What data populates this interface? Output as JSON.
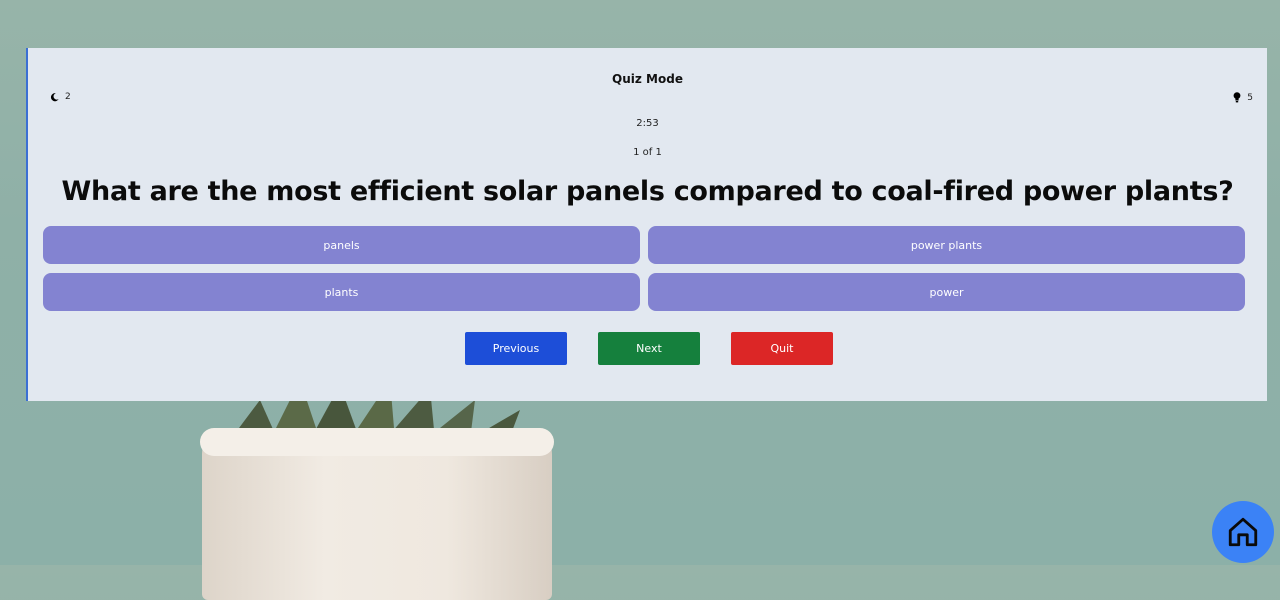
{
  "quiz": {
    "title": "Quiz Mode",
    "left_stat": {
      "icon": "moon-icon",
      "value": "2"
    },
    "right_stat": {
      "icon": "lightbulb-icon",
      "value": "5"
    },
    "timer": "2:53",
    "progress": "1 of 1",
    "question": "What are the most efficient solar panels compared to coal-fired power plants?",
    "options": [
      "panels",
      "power plants",
      "plants",
      "power"
    ]
  },
  "nav": {
    "previous_label": "Previous",
    "next_label": "Next",
    "quit_label": "Quit"
  },
  "home_button": {
    "icon": "home-icon"
  },
  "colors": {
    "card_bg": "#e2e8f0",
    "option_bg": "#8383d1",
    "previous_bg": "#1d4ed8",
    "next_bg": "#15803d",
    "quit_bg": "#dc2626",
    "home_bg": "#3b82f6"
  }
}
